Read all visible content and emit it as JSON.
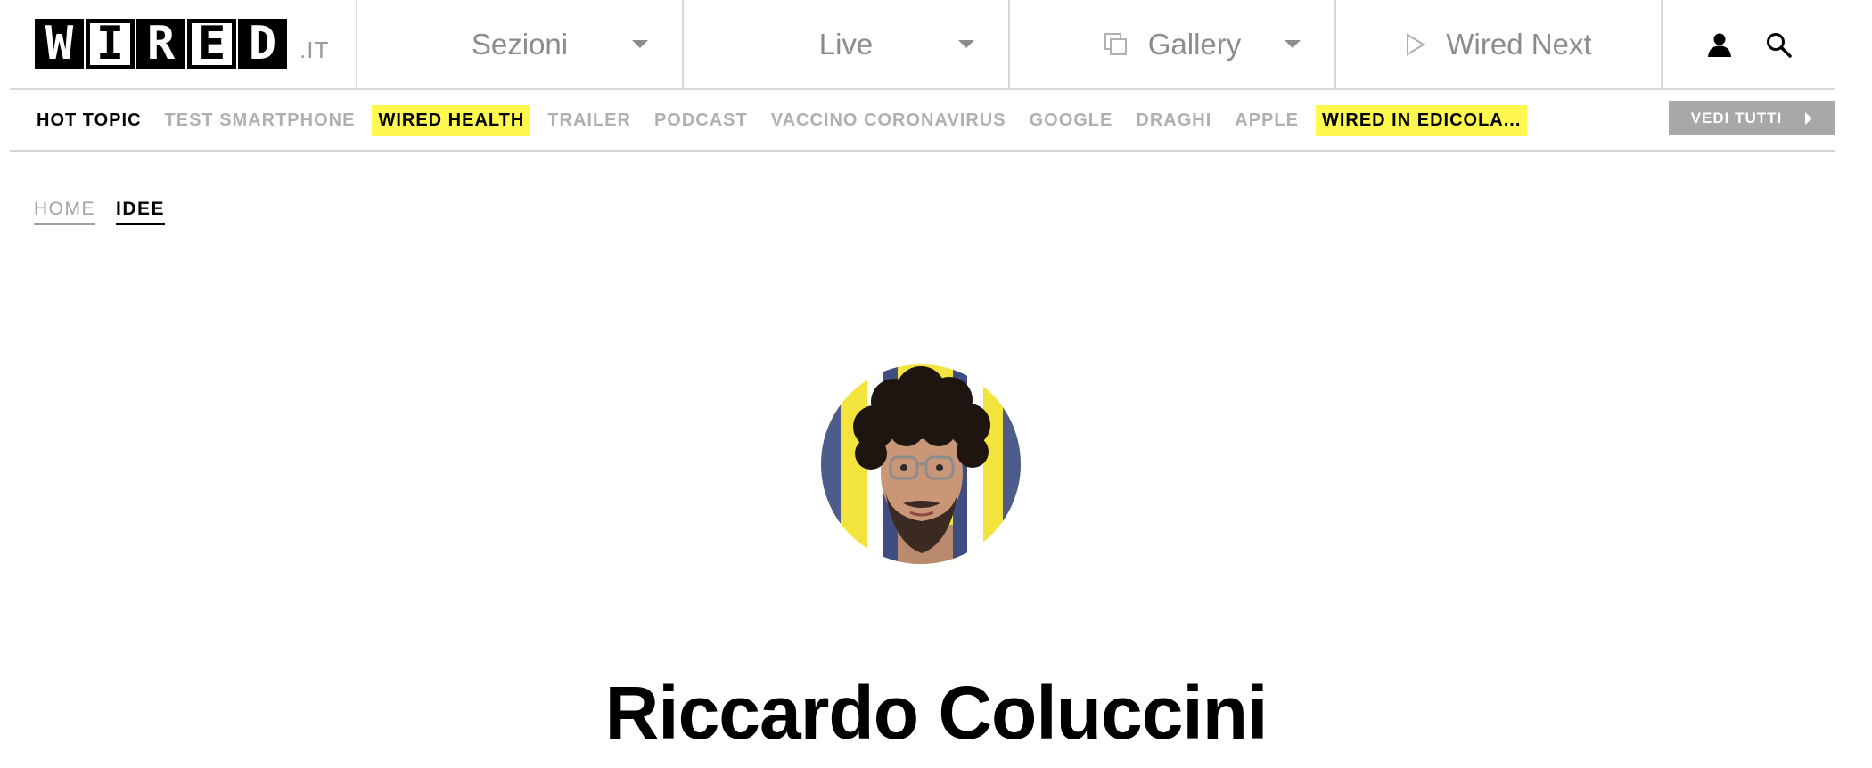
{
  "header": {
    "logo_letters": [
      "W",
      "I",
      "R",
      "E",
      "D"
    ],
    "logo_suffix": ".IT",
    "nav": [
      {
        "label": "Sezioni",
        "icon": "chevron-down-icon"
      },
      {
        "label": "Live",
        "icon": "chevron-down-icon"
      },
      {
        "label": "Gallery",
        "icon": "gallery-icon"
      },
      {
        "label": "Wired Next",
        "icon": "play-icon"
      }
    ],
    "icons": [
      "user-icon",
      "search-icon"
    ]
  },
  "hot_topics": {
    "label": "HOT TOPIC",
    "items": [
      {
        "label": "TEST SMARTPHONE",
        "highlight": false
      },
      {
        "label": "WIRED HEALTH",
        "highlight": true
      },
      {
        "label": "TRAILER",
        "highlight": false
      },
      {
        "label": "PODCAST",
        "highlight": false
      },
      {
        "label": "VACCINO CORONAVIRUS",
        "highlight": false
      },
      {
        "label": "GOOGLE",
        "highlight": false
      },
      {
        "label": "DRAGHI",
        "highlight": false
      },
      {
        "label": "APPLE",
        "highlight": false
      },
      {
        "label": "WIRED IN EDICOLA...",
        "highlight": true
      }
    ],
    "see_all_label": "VEDI TUTTI"
  },
  "breadcrumb": [
    {
      "label": "HOME"
    },
    {
      "label": "IDEE"
    }
  ],
  "author": {
    "name": "Riccardo Coluccini"
  },
  "colors": {
    "highlight": "#fff94f",
    "muted": "#b0b0b0",
    "nav_text": "#8c8c8c"
  }
}
